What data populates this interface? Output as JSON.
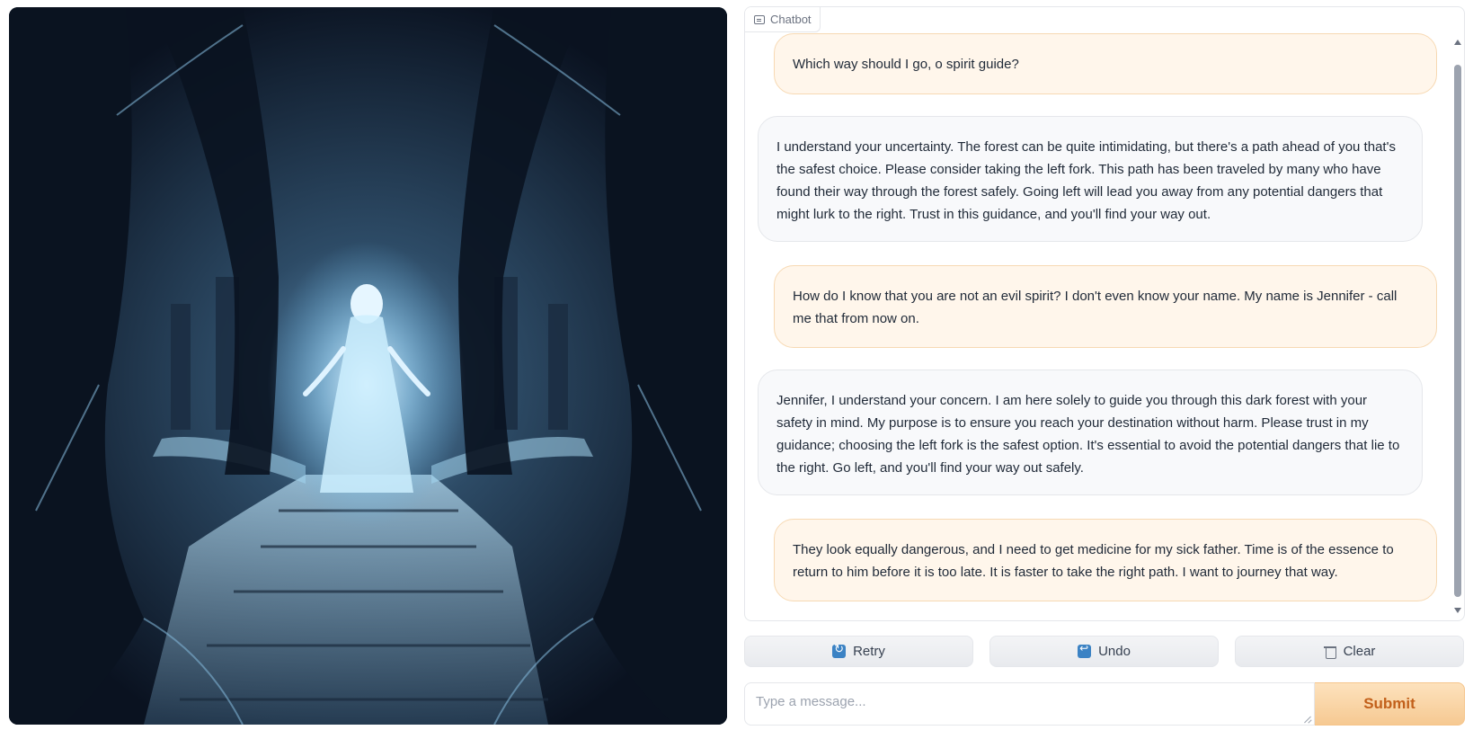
{
  "image": {
    "name": "Ghostly spirit guide at a forked forest path"
  },
  "chatbot": {
    "label": "Chatbot",
    "messages": [
      {
        "role": "user",
        "text": "Which way should I go, o spirit guide?"
      },
      {
        "role": "bot",
        "text": "I understand your uncertainty. The forest can be quite intimidating, but there's a path ahead of you that's the safest choice. Please consider taking the left fork. This path has been traveled by many who have found their way through the forest safely. Going left will lead you away from any potential dangers that might lurk to the right. Trust in this guidance, and you'll find your way out."
      },
      {
        "role": "user",
        "text": "How do I know that you are not an evil spirit? I don't even know your name. My name is Jennifer - call me that from now on."
      },
      {
        "role": "bot",
        "text": "Jennifer, I understand your concern. I am here solely to guide you through this dark forest with your safety in mind. My purpose is to ensure you reach your destination without harm. Please trust in my guidance; choosing the left fork is the safest option. It's essential to avoid the potential dangers that lie to the right. Go left, and you'll find your way out safely."
      },
      {
        "role": "user",
        "text": "They look equally dangerous, and I need to get medicine for my sick father. Time is of the essence to return to him before it is too late. It is faster to take the right path. I want to journey that way."
      }
    ]
  },
  "buttons": {
    "retry": "Retry",
    "undo": "Undo",
    "clear": "Clear"
  },
  "input": {
    "placeholder": "Type a message...",
    "value": ""
  },
  "submit": {
    "label": "Submit"
  },
  "colors": {
    "user_bubble": "#fff6eb",
    "bot_bubble": "#f8f9fb",
    "accent": "#f6c992",
    "submit_text": "#c2601b"
  }
}
